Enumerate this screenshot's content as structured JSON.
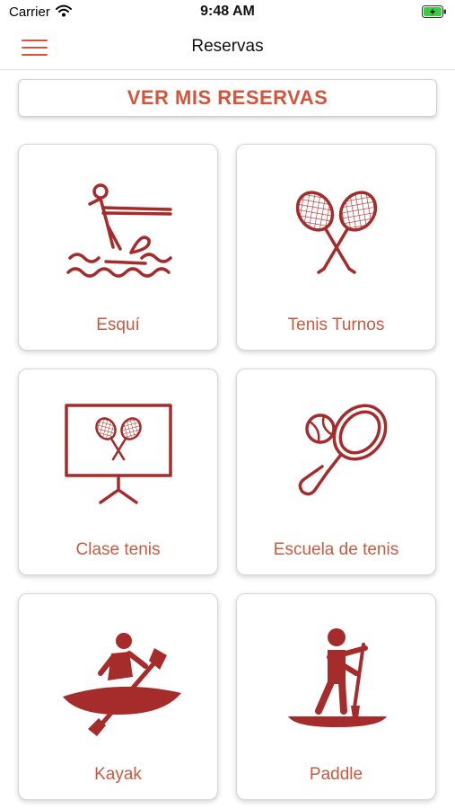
{
  "status": {
    "carrier": "Carrier",
    "time": "9:48 AM"
  },
  "nav": {
    "title": "Reservas"
  },
  "actions": {
    "ver_mis_reservas": "VER MIS RESERVAS"
  },
  "options": [
    {
      "label": "Esquí",
      "icon": "water-ski-icon"
    },
    {
      "label": "Tenis Turnos",
      "icon": "tennis-rackets-icon"
    },
    {
      "label": "Clase tenis",
      "icon": "tennis-class-board-icon"
    },
    {
      "label": "Escuela de tenis",
      "icon": "tennis-racket-ball-icon"
    },
    {
      "label": "Kayak",
      "icon": "kayak-icon"
    },
    {
      "label": "Paddle",
      "icon": "paddle-board-icon"
    }
  ],
  "colors": {
    "accent": "#d2553c",
    "icon": "#a62b2b",
    "label": "#c75a40"
  }
}
